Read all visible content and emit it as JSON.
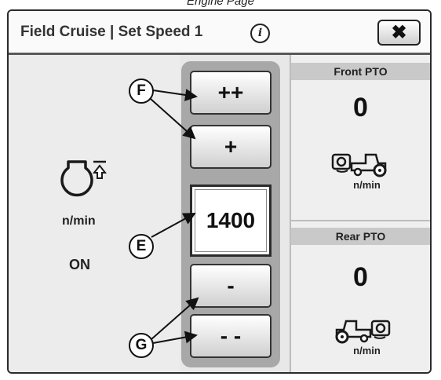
{
  "page_caption": "Engine Page",
  "title_bar": {
    "title": "Field Cruise | Set Speed 1",
    "info_icon": "info-icon",
    "close_label": "✖"
  },
  "engine": {
    "icon": "engine-speed-icon",
    "unit": "n/min",
    "state": "ON"
  },
  "speed_control": {
    "increase_fast_label": "++",
    "increase_label": "+",
    "set_value": "1400",
    "decrease_label": "-",
    "decrease_fast_label": "- -"
  },
  "front_pto": {
    "header": "Front PTO",
    "value": "0",
    "unit": "n/min",
    "icon": "front-pto-tractor-icon"
  },
  "rear_pto": {
    "header": "Rear PTO",
    "value": "0",
    "unit": "n/min",
    "icon": "rear-pto-tractor-icon"
  },
  "callouts": {
    "f": "F",
    "e": "E",
    "g": "G"
  },
  "colors": {
    "title_bar": "#fafafa",
    "button_column": "#a8a8a8",
    "pto_header": "#c9c9c9",
    "border": "#2b2b2b"
  }
}
